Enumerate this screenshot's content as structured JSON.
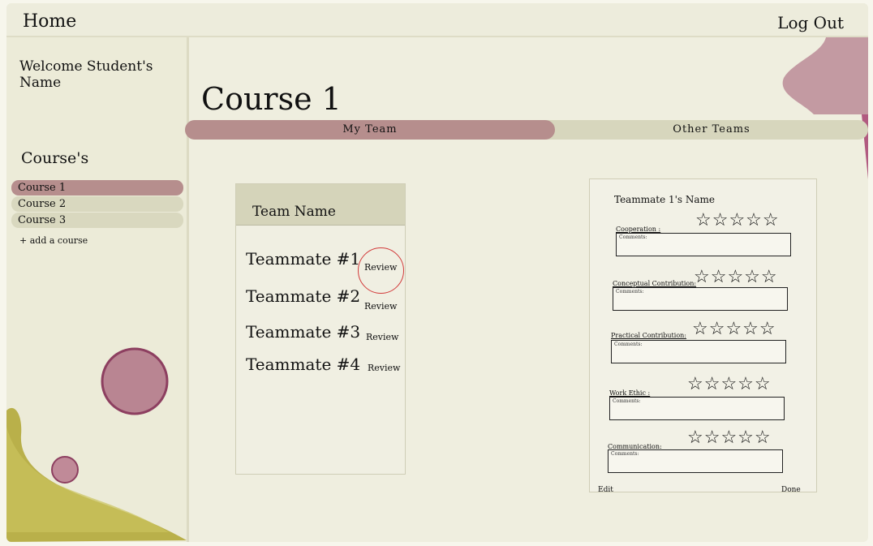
{
  "topbar": {
    "home": "Home",
    "logout": "Log Out"
  },
  "sidebar": {
    "welcome": "Welcome Student's Name",
    "courses_title": "Course's",
    "courses": [
      "Course 1",
      "Course 2",
      "Course 3"
    ],
    "add_course": "+ add a course"
  },
  "main": {
    "title": "Course 1",
    "tabs": {
      "my_team": "My Team",
      "other_teams": "Other Teams"
    }
  },
  "team": {
    "name": "Team Name",
    "members": [
      {
        "name": "Teammate #1",
        "action": "Review"
      },
      {
        "name": "Teammate #2",
        "action": "Review"
      },
      {
        "name": "Teammate #3",
        "action": "Review"
      },
      {
        "name": "Teammate #4",
        "action": "Review"
      }
    ]
  },
  "evaluation": {
    "teammate_name": "Teammate 1's Name",
    "criteria": [
      {
        "label": "Cooperation :",
        "stars": "☆☆☆☆☆",
        "comments": "Comments:"
      },
      {
        "label": "Conceptual Contribution:",
        "stars": "☆☆☆☆☆",
        "comments": "Comments:"
      },
      {
        "label": "Practical Contribution:",
        "stars": "☆☆☆☆☆",
        "comments": "Comments:"
      },
      {
        "label": "Work Ethic :",
        "stars": "☆☆☆☆☆",
        "comments": "Comments:"
      },
      {
        "label": "Communication:",
        "stars": "☆☆☆☆☆",
        "comments": "Comments:"
      }
    ],
    "edit": "Edit",
    "done": "Done"
  },
  "colors": {
    "accent_rose": "#b68e8d",
    "tab_inactive": "#d7d6bd",
    "deco_olive": "#b9b04a",
    "deco_plum": "#9b4d6b",
    "review_highlight": "#d23a3a"
  }
}
